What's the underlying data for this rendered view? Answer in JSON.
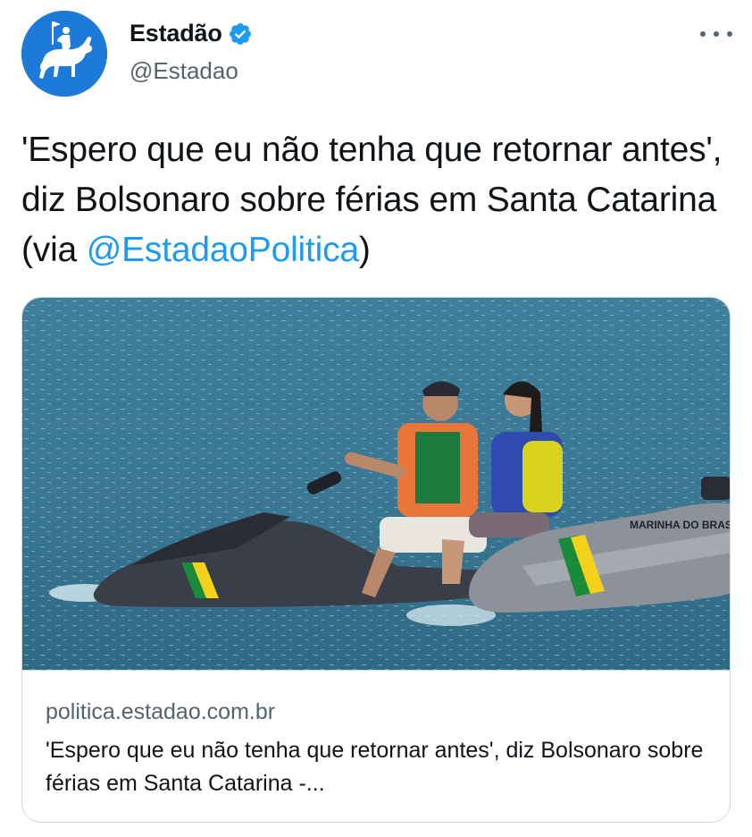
{
  "author": {
    "display_name": "Estadão",
    "handle": "@Estadao",
    "verified": true,
    "avatar_color": "#1d7ad9"
  },
  "menu": {
    "more_icon": "more-horizontal-icon"
  },
  "tweet": {
    "text_before": "'Espero que eu não tenha que retornar antes', diz Bolsonaro sobre férias em Santa Catarina (via ",
    "mention": "@EstadaoPolitica",
    "text_after": ")"
  },
  "link_card": {
    "image_description": "photo",
    "watercraft_label": "MARINHA DO BRASIL",
    "domain": "politica.estadao.com.br",
    "title": "'Espero que eu não tenha que retornar antes', diz Bolsonaro sobre férias em Santa Catarina -..."
  },
  "colors": {
    "link": "#1d9bf0",
    "secondary_text": "#536471",
    "border": "#cfd9de",
    "verified": "#1d9bf0"
  }
}
